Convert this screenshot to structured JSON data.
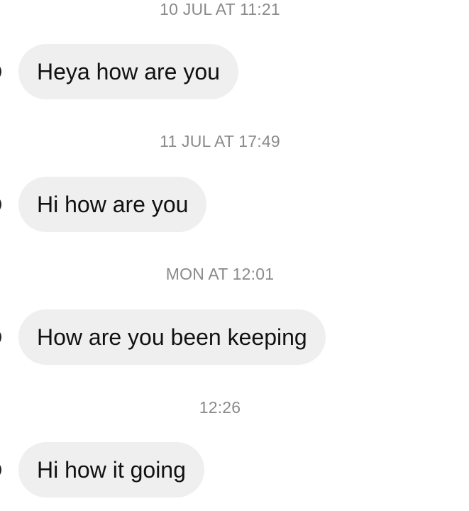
{
  "conversation": {
    "groups": [
      {
        "timestamp": "10 JUL AT 11:21",
        "message": "Heya how are you"
      },
      {
        "timestamp": "11 JUL AT 17:49",
        "message": "Hi how are you"
      },
      {
        "timestamp": "MON AT 12:01",
        "message": "How are you been keeping"
      },
      {
        "timestamp": "12:26",
        "message": "Hi how it going"
      }
    ]
  }
}
